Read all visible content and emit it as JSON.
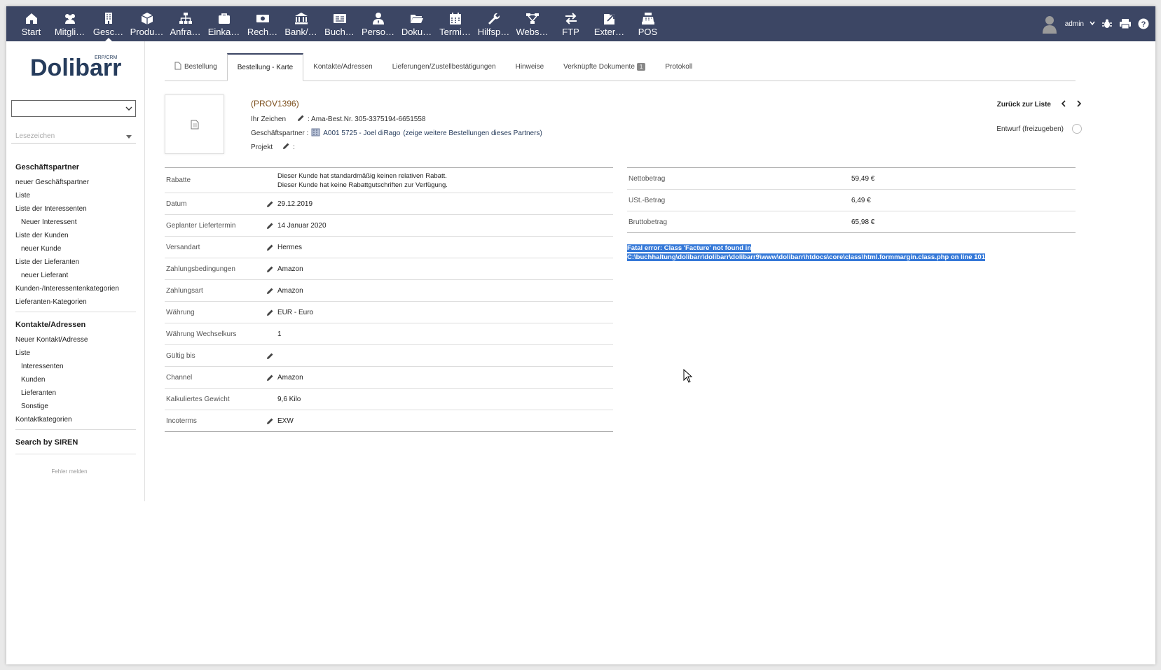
{
  "topmenu": [
    {
      "label": "Start",
      "icon": "home-icon"
    },
    {
      "label": "Mitgli…",
      "icon": "members-icon"
    },
    {
      "label": "Gesc…",
      "icon": "building-icon",
      "active": true
    },
    {
      "label": "Produ…",
      "icon": "cube-icon"
    },
    {
      "label": "Anfra…",
      "icon": "sitemap-icon"
    },
    {
      "label": "Einka…",
      "icon": "briefcase-icon"
    },
    {
      "label": "Rech…",
      "icon": "money-icon"
    },
    {
      "label": "Bank/…",
      "icon": "bank-icon"
    },
    {
      "label": "Buch…",
      "icon": "ledger-icon"
    },
    {
      "label": "Perso…",
      "icon": "user-tie-icon"
    },
    {
      "label": "Doku…",
      "icon": "folder-open-icon"
    },
    {
      "label": "Termi…",
      "icon": "calendar-icon"
    },
    {
      "label": "Hilfsp…",
      "icon": "wrench-icon"
    },
    {
      "label": "Webs…",
      "icon": "network-icon"
    },
    {
      "label": "FTP",
      "icon": "exchange-icon"
    },
    {
      "label": "Exter…",
      "icon": "external-link-icon"
    },
    {
      "label": "POS",
      "icon": "cash-register-icon"
    }
  ],
  "user": {
    "name": "admin"
  },
  "sidebar": {
    "logo": "Dolibarr",
    "logo_sub": "ERP/CRM",
    "bookmark_placeholder": "Lesezeichen",
    "sections": [
      {
        "head": "Geschäftspartner",
        "items": [
          {
            "label": "neuer Geschäftspartner",
            "sub": false
          },
          {
            "label": "Liste",
            "sub": false
          },
          {
            "label": "Liste der Interessenten",
            "sub": false
          },
          {
            "label": "Neuer Interessent",
            "sub": true
          },
          {
            "label": "Liste der Kunden",
            "sub": false
          },
          {
            "label": "neuer Kunde",
            "sub": true
          },
          {
            "label": "Liste der Lieferanten",
            "sub": false
          },
          {
            "label": "neuer Lieferant",
            "sub": true
          },
          {
            "label": "Kunden-/Interessentenkategorien",
            "sub": false
          },
          {
            "label": "Lieferanten-Kategorien",
            "sub": false
          }
        ]
      },
      {
        "head": "Kontakte/Adressen",
        "items": [
          {
            "label": "Neuer Kontakt/Adresse",
            "sub": false
          },
          {
            "label": "Liste",
            "sub": false
          },
          {
            "label": "Interessenten",
            "sub": true
          },
          {
            "label": "Kunden",
            "sub": true
          },
          {
            "label": "Lieferanten",
            "sub": true
          },
          {
            "label": "Sonstige",
            "sub": true
          },
          {
            "label": "Kontaktkategorien",
            "sub": false
          }
        ]
      },
      {
        "head": "Search by SIREN",
        "items": []
      }
    ],
    "report_bug": "Fehler melden"
  },
  "tabs": [
    {
      "label": "Bestellung",
      "icon": true
    },
    {
      "label": "Bestellung - Karte",
      "active": true
    },
    {
      "label": "Kontakte/Adressen"
    },
    {
      "label": "Lieferungen/Zustellbestätigungen"
    },
    {
      "label": "Hinweise"
    },
    {
      "label": "Verknüpfte Dokumente",
      "badge": "1"
    },
    {
      "label": "Protokoll"
    }
  ],
  "order": {
    "ref": "(PROV1396)",
    "ref_customer_label": "Ihr Zeichen",
    "ref_customer_value": ": Ama-Best.Nr. 305-3375194-6651558",
    "thirdparty_label": "Geschäftspartner :",
    "thirdparty_value": "A001 5725 - Joel diRago",
    "thirdparty_more": "(zeige weitere Bestellungen dieses Partners)",
    "project_label": "Projekt",
    "project_value": ":",
    "back_to_list": "Zurück zur Liste",
    "status": "Entwurf (freizugeben)"
  },
  "fields": [
    {
      "label": "Rabatte",
      "editable": false,
      "value": "Dieser Kunde hat standardmäßig keinen relativen Rabatt.",
      "value2": "Dieser Kunde hat keine Rabattgutschriften zur Verfügung."
    },
    {
      "label": "Datum",
      "editable": true,
      "value": "29.12.2019"
    },
    {
      "label": "Geplanter Liefertermin",
      "editable": true,
      "value": "14 Januar 2020"
    },
    {
      "label": "Versandart",
      "editable": true,
      "value": "Hermes"
    },
    {
      "label": "Zahlungsbedingungen",
      "editable": true,
      "value": "Amazon"
    },
    {
      "label": "Zahlungsart",
      "editable": true,
      "value": "Amazon"
    },
    {
      "label": "Währung",
      "editable": true,
      "value": "EUR - Euro"
    },
    {
      "label": "Währung Wechselkurs",
      "editable": false,
      "value": "1"
    },
    {
      "label": "Gültig bis",
      "editable": true,
      "value": ""
    },
    {
      "label": "Channel",
      "editable": true,
      "value": "Amazon"
    },
    {
      "label": "Kalkuliertes Gewicht",
      "editable": false,
      "value": "9,6 Kilo"
    },
    {
      "label": "Incoterms",
      "editable": true,
      "value": "EXW"
    }
  ],
  "totals": [
    {
      "label": "Nettobetrag",
      "value": "59,49 €"
    },
    {
      "label": "USt.-Betrag",
      "value": "6,49 €"
    },
    {
      "label": "Bruttobetrag",
      "value": "65,98 €"
    }
  ],
  "error": {
    "line1": "Fatal error: Class 'Facture' not found in",
    "line2": "C:\\buchhaltung\\dolibarr\\dolibarr\\dolibarr9\\www\\dolibarr\\htdocs\\core\\class\\html.formmargin.class.php on line 101"
  },
  "colors": {
    "topbar": "#3c4664",
    "ref": "#7c4f1c",
    "selection": "#3478d8"
  }
}
